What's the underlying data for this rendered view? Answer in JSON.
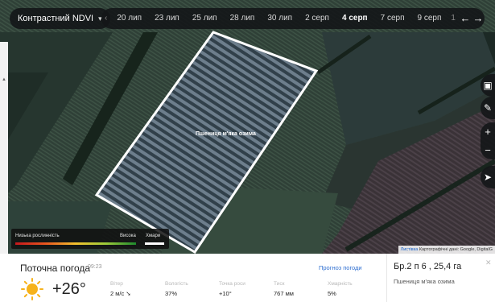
{
  "toolbar": {
    "ndvi_select": "Контрастний NDVI",
    "dates": [
      "20 лип",
      "23 лип",
      "25 лип",
      "28 лип",
      "30 лип",
      "2 серп",
      "4 серп",
      "7 серп",
      "9 серп",
      "1"
    ],
    "active_date": "4 серп",
    "prev_icon": "arrow-left-icon",
    "next_icon": "arrow-right-icon"
  },
  "map": {
    "field_label": "Пшениця м'яка озима"
  },
  "legend": {
    "low": "Низька рослинність",
    "high": "Висока",
    "clouds": "Хмари"
  },
  "attribution": {
    "link": "Листівка",
    "text": "Картографічні дані: Google, DigitalG"
  },
  "weather": {
    "title": "Поточна погода",
    "time": "09:23",
    "forecast_link": "Прогноз погоди",
    "temperature": "+26°",
    "metrics": [
      {
        "label": "Вітер",
        "value": "2 м/с"
      },
      {
        "label": "Вологість",
        "value": "37%"
      },
      {
        "label": "Точка роси",
        "value": "+10°"
      },
      {
        "label": "Тиск",
        "value": "767 мм"
      },
      {
        "label": "Хмарність",
        "value": "5%"
      }
    ]
  },
  "field_info": {
    "name": "Бр.2 п 6 , 25,4 га",
    "crop": "Пшениця м'яка озима"
  },
  "colors": {
    "accent": "#2f6fd1",
    "toolbar_bg": "#141618",
    "field_outline": "#ffffff"
  }
}
